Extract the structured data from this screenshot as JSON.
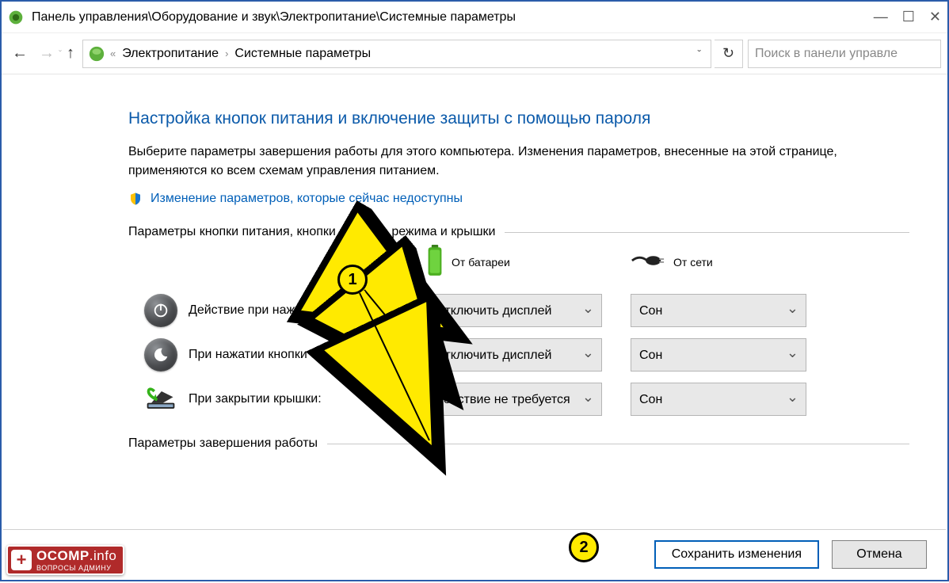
{
  "window": {
    "title": "Панель управления\\Оборудование и звук\\Электропитание\\Системные параметры"
  },
  "breadcrumb": {
    "prefix_chev": "«",
    "item1": "Электропитание",
    "item2": "Системные параметры"
  },
  "search": {
    "placeholder": "Поиск в панели управле"
  },
  "page": {
    "heading": "Настройка кнопок питания и включение защиты с помощью пароля",
    "description": "Выберите параметры завершения работы для этого компьютера. Изменения параметров, внесенные на этой странице, применяются ко всем схемам управления питанием.",
    "admin_link": "Изменение параметров, которые сейчас недоступны",
    "section1_title": "Параметры кнопки питания, кнопки спящего режима и крышки",
    "section2_title": "Параметры завершения работы",
    "col_battery": "От батареи",
    "col_ac": "От сети",
    "rows": [
      {
        "label": "Действие при нажатии кнопки питания:",
        "battery": "Отключить дисплей",
        "ac": "Сон"
      },
      {
        "label": "При нажатии кнопки сна:",
        "battery": "Отключить дисплей",
        "ac": "Сон"
      },
      {
        "label": "При закрытии крышки:",
        "battery": "Действие не требуется",
        "ac": "Сон"
      }
    ],
    "save_label": "Сохранить изменения",
    "cancel_label": "Отмена"
  },
  "annotations": {
    "marker1": "1",
    "marker2": "2"
  },
  "watermark": {
    "main1": "OCOMP",
    "main2": ".info",
    "sub": "ВОПРОСЫ АДМИНУ"
  }
}
